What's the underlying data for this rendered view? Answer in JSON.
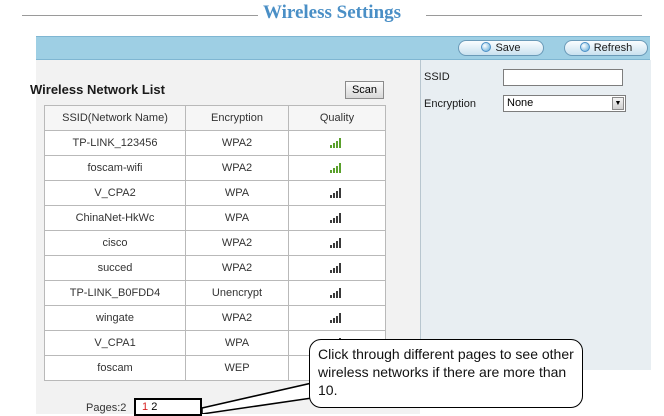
{
  "page_title": "Wireless Settings",
  "toolbar": {
    "save_label": "Save",
    "refresh_label": "Refresh"
  },
  "list": {
    "title": "Wireless Network List",
    "scan_label": "Scan",
    "columns": [
      "SSID(Network Name)",
      "Encryption",
      "Quality"
    ],
    "rows": [
      {
        "ssid": "TP-LINK_123456",
        "encryption": "WPA2",
        "quality_bars": 4
      },
      {
        "ssid": "foscam-wifi",
        "encryption": "WPA2",
        "quality_bars": 4
      },
      {
        "ssid": "V_CPA2",
        "encryption": "WPA",
        "quality_bars": 2
      },
      {
        "ssid": "ChinaNet-HkWc",
        "encryption": "WPA",
        "quality_bars": 2
      },
      {
        "ssid": "cisco",
        "encryption": "WPA2",
        "quality_bars": 2
      },
      {
        "ssid": "succed",
        "encryption": "WPA2",
        "quality_bars": 2
      },
      {
        "ssid": "TP-LINK_B0FDD4",
        "encryption": "Unencrypt",
        "quality_bars": 2
      },
      {
        "ssid": "wingate",
        "encryption": "WPA2",
        "quality_bars": 2
      },
      {
        "ssid": "V_CPA1",
        "encryption": "WPA",
        "quality_bars": 2
      },
      {
        "ssid": "foscam",
        "encryption": "WEP",
        "quality_bars": 2
      }
    ],
    "pages_label": "Pages:2",
    "pages": [
      "1",
      "2"
    ],
    "active_page": "1"
  },
  "form": {
    "ssid_label": "SSID",
    "ssid_value": "",
    "encryption_label": "Encryption",
    "encryption_value": "None"
  },
  "callout": {
    "text": "Click through different pages to see other wireless networks if there are more than 10."
  },
  "colors": {
    "title": "#4a8fc6",
    "toolbar": "#9ecfe4",
    "signal_strong": "#5aa02c",
    "signal_weak": "#3a3a3a",
    "active_page": "#d61f1f"
  },
  "icons": {
    "signal": "signal-bars-icon",
    "button_dot": "radio-dot-icon",
    "dropdown": "dropdown-arrow-icon"
  }
}
